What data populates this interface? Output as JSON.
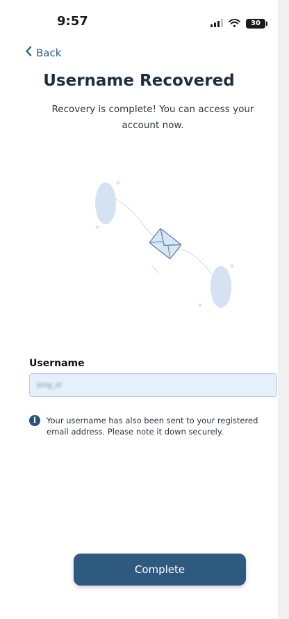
{
  "status_bar": {
    "time": "9:57",
    "battery": "30",
    "icons": [
      "signal-icon",
      "wifi-icon",
      "battery-icon"
    ]
  },
  "nav": {
    "back_label": "Back"
  },
  "header": {
    "title": "Username Recovered",
    "subtitle": "Recovery is complete! You can access your account now."
  },
  "illustration": {
    "icons": [
      "envelope-icon"
    ],
    "accent_color": "#d4e2f1"
  },
  "form": {
    "username_label": "Username",
    "username_value": "jong_st"
  },
  "info": {
    "icon": "info-icon",
    "text": "Your username has also been sent to your registered email address. Please note it down securely."
  },
  "actions": {
    "complete_label": "Complete"
  },
  "colors": {
    "primary": "#2e5a80",
    "back_link": "#2f5f86",
    "field_background": "#e6f0fb"
  }
}
